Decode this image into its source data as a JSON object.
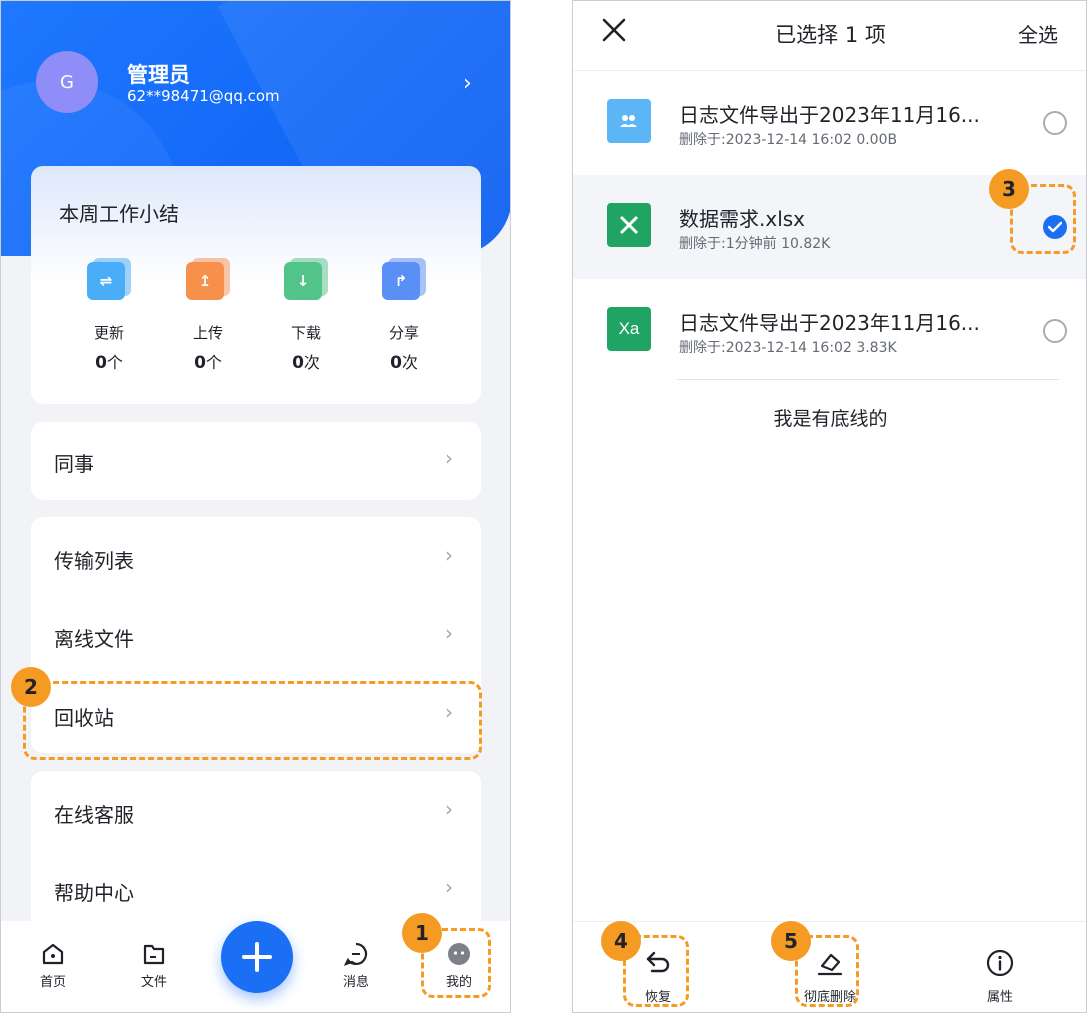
{
  "left": {
    "profile": {
      "avatar_letter": "G",
      "name": "管理员",
      "email": "62**98471@qq.com"
    },
    "summary": {
      "title": "本周工作小结",
      "stats": [
        {
          "label": "更新",
          "value": "0",
          "unit": "个",
          "icon": "update-icon",
          "color": "#2f9bf5"
        },
        {
          "label": "上传",
          "value": "0",
          "unit": "个",
          "icon": "upload-icon",
          "color": "#f5833a"
        },
        {
          "label": "下载",
          "value": "0",
          "unit": "次",
          "icon": "download-icon",
          "color": "#3cb878"
        },
        {
          "label": "分享",
          "value": "0",
          "unit": "次",
          "icon": "share-icon",
          "color": "#3d7bf2"
        }
      ]
    },
    "menu": {
      "colleagues": "同事",
      "transfer_list": "传输列表",
      "offline_files": "离线文件",
      "recycle_bin": "回收站",
      "online_service": "在线客服",
      "help_center": "帮助中心"
    },
    "tabbar": {
      "home": "首页",
      "files": "文件",
      "messages": "消息",
      "me": "我的"
    }
  },
  "right": {
    "header": {
      "title": "已选择 1 项",
      "select_all": "全选"
    },
    "files": [
      {
        "name": "日志文件导出于2023年11月16...",
        "meta": "删除于:2023-12-14 16:02  0.00B",
        "type": "shared-folder-icon",
        "selected": false
      },
      {
        "name": "数据需求.xlsx",
        "meta": "删除于:1分钟前  10.82K",
        "type": "excel-icon",
        "selected": true
      },
      {
        "name": "日志文件导出于2023年11月16...",
        "meta": "删除于:2023-12-14 16:02  3.83K",
        "type": "excel-online-icon",
        "selected": false
      }
    ],
    "footer_note": "我是有底线的",
    "actions": {
      "restore": "恢复",
      "delete_permanently": "彻底删除",
      "properties": "属性"
    }
  },
  "annotations": [
    "1",
    "2",
    "3",
    "4",
    "5"
  ],
  "colors": {
    "accent": "#1b6ff5",
    "annotation": "#f59a23"
  }
}
